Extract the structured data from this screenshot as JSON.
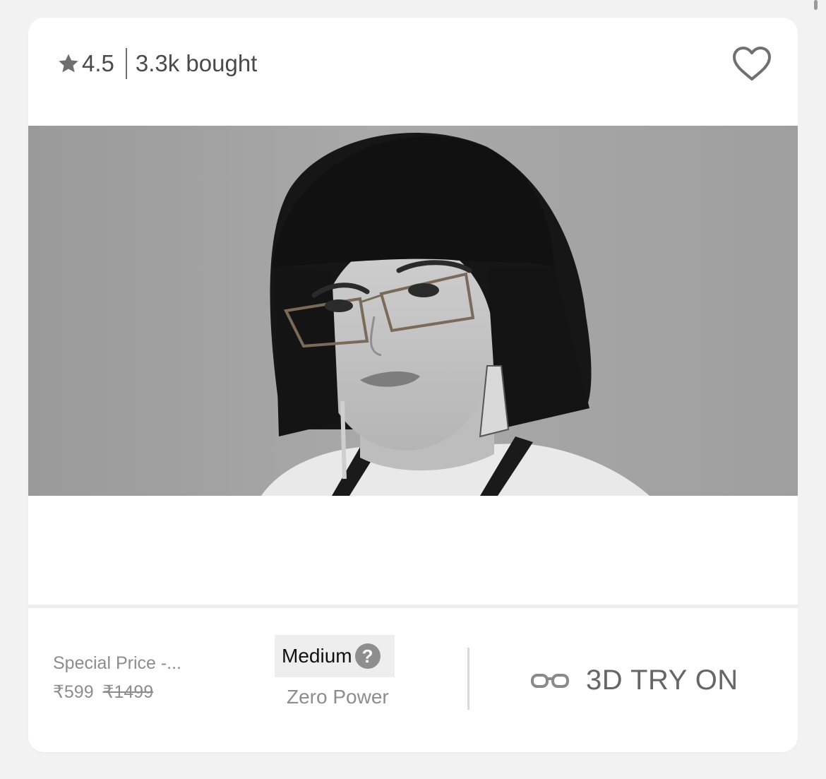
{
  "product_card": {
    "rating": "4.5",
    "bought": "3.3k bought",
    "price_label": "Special Price -...",
    "price_current": "₹599",
    "price_original": "₹1499",
    "size": "Medium",
    "help_glyph": "?",
    "power": "Zero Power",
    "try_on_label": "3D TRY ON"
  },
  "icons": [
    "star-icon",
    "heart-outline-icon",
    "help-circle-icon",
    "glasses-icon"
  ],
  "colors": {
    "background": "#f2f2f2",
    "card": "#ffffff",
    "text_dark": "#4a4a4a",
    "text_muted": "#8d8d8d",
    "chip": "#eeeeee"
  }
}
